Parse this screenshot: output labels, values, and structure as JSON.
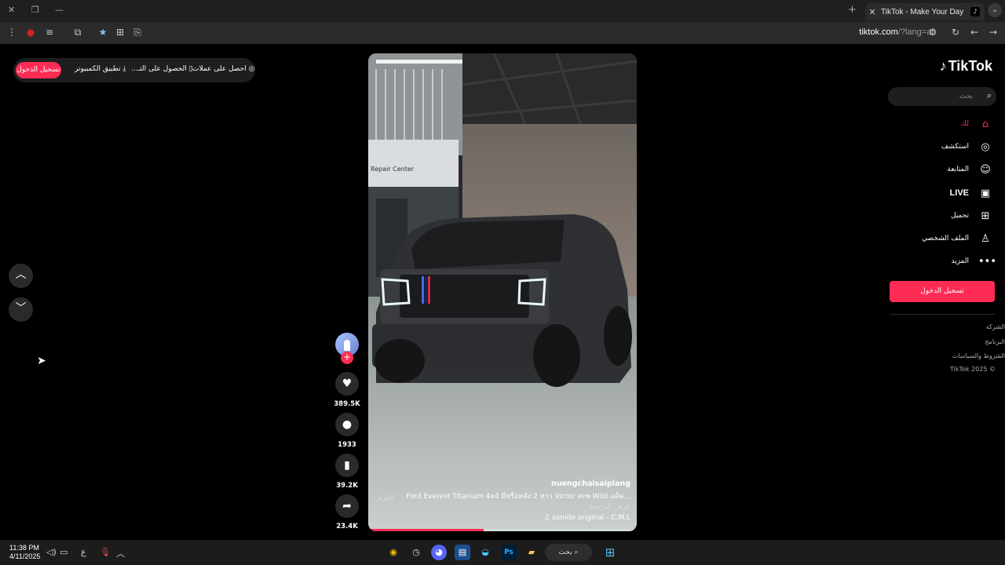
{
  "browser": {
    "tab_title": "TikTok - Make Your Day",
    "tab_close": "✕",
    "new_tab": "+",
    "url_host": "tiktok.com",
    "url_path": "/?lang=ar"
  },
  "topbar": {
    "login": "تسجيل الدخول",
    "desktop_app": "تطبيق الكمبيوتر",
    "get_app": "الحصول على التـ...",
    "get_coins": "احصل على عملات"
  },
  "video": {
    "author": "nuengchaisaiplang",
    "caption": "Ford Everest Titanium 4x4 มีหรือหลัง 2 ห่าว Victor ละพ Wild แด้ด...",
    "more": "المزيد",
    "translate": "عرض الترجمة",
    "sound": "♫ sonido original - C.M.L",
    "progress": 0.43
  },
  "actions": {
    "likes": "389.5K",
    "comments": "1933",
    "saves": "39.2K",
    "shares": "23.4K"
  },
  "sidebar": {
    "logo": "TikTok",
    "search_placeholder": "بحث",
    "nav": [
      {
        "label": "لك"
      },
      {
        "label": "استكشف"
      },
      {
        "label": "المتابعة"
      },
      {
        "label": "LIVE"
      },
      {
        "label": "تحميل"
      },
      {
        "label": "الملف الشخصي"
      },
      {
        "label": "المزيد"
      }
    ],
    "login_button": "تسجيل الدخول",
    "footer": [
      "الشركة",
      "البرنامج",
      "الشروط والسياسات",
      "TikTok 2025 ©"
    ]
  },
  "taskbar": {
    "time": "11:38 PM",
    "date": "4/11/2025",
    "lang": "ع",
    "search": "بحث"
  },
  "colors": {
    "accent": "#fe2c55",
    "background": "#000000"
  }
}
